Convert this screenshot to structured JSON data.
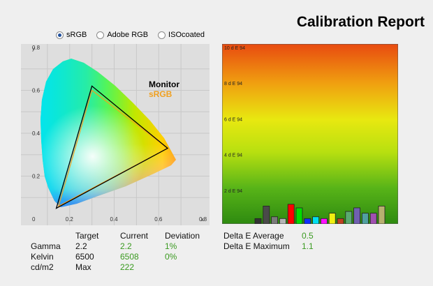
{
  "title": "Calibration Report",
  "gamut_options": [
    {
      "label": "sRGB",
      "selected": true
    },
    {
      "label": "Adobe RGB",
      "selected": false
    },
    {
      "label": "ISOcoated",
      "selected": false
    }
  ],
  "cie_chart": {
    "type": "scatter",
    "xlabel": "x",
    "ylabel": "y",
    "x_ticks": [
      "0",
      "0.2",
      "0.4",
      "0.6",
      "0.8"
    ],
    "y_ticks": [
      "0.8",
      "0.6",
      "0.4",
      "0.2"
    ],
    "xlim": [
      0,
      0.8
    ],
    "ylim": [
      0,
      0.8
    ],
    "legend": [
      {
        "label": "Monitor",
        "color": "#000000"
      },
      {
        "label": "sRGB",
        "color": "#f0a020"
      }
    ],
    "monitor_gamut": [
      [
        0.3,
        0.62
      ],
      [
        0.64,
        0.33
      ],
      [
        0.14,
        0.05
      ]
    ],
    "srgb_gamut": [
      [
        0.3,
        0.6
      ],
      [
        0.64,
        0.33
      ],
      [
        0.15,
        0.06
      ]
    ]
  },
  "chart_data": {
    "type": "bar",
    "ylabel_unit": "d E 94",
    "y_ticks": [
      "10 d E 94",
      "8 d E 94",
      "6 d E 94",
      "4 d E 94",
      "2 d E 94"
    ],
    "ylim": [
      0,
      10
    ],
    "values": [
      0.3,
      1.0,
      0.4,
      0.3,
      1.1,
      0.9,
      0.3,
      0.4,
      0.3,
      0.6,
      0.3,
      0.7,
      0.9,
      0.6,
      0.6,
      1.0
    ],
    "colors": [
      "#333333",
      "#4a4a4a",
      "#7a7a7a",
      "#b5b5b5",
      "#ff0000",
      "#00dd00",
      "#1030ff",
      "#00e0f0",
      "#ff10ff",
      "#f0f010",
      "#c04020",
      "#5aaa70",
      "#7060b0",
      "#50a0a0",
      "#a050b0",
      "#b8b070"
    ]
  },
  "stats": {
    "headers": {
      "target": "Target",
      "current": "Current",
      "deviation": "Deviation"
    },
    "rows": [
      {
        "label": "Gamma",
        "target": "2.2",
        "current": "2.2",
        "deviation": "1%"
      },
      {
        "label": "Kelvin",
        "target": "6500",
        "current": "6508",
        "deviation": "0%"
      },
      {
        "label": "cd/m2",
        "target": "Max",
        "current": "222",
        "deviation": ""
      }
    ]
  },
  "delta_e": {
    "average_label": "Delta E Average",
    "average_value": "0.5",
    "maximum_label": "Delta E Maximum",
    "maximum_value": "1.1"
  }
}
